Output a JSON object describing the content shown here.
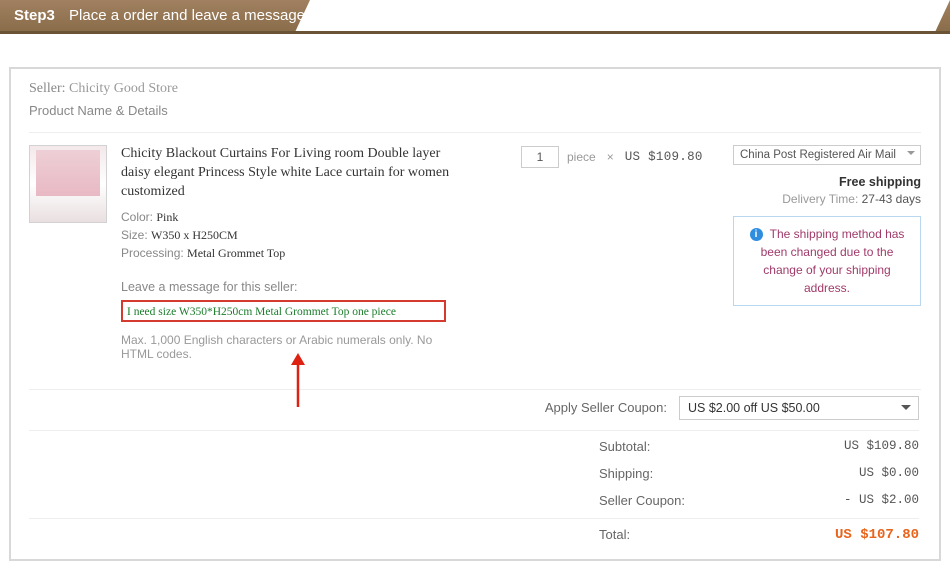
{
  "header": {
    "step": "Step3",
    "title": "Place a order and leave a message"
  },
  "seller": {
    "label": "Seller:",
    "name": "Chicity Good Store"
  },
  "product_name_details_label": "Product Name & Details",
  "product": {
    "title": "Chicity Blackout Curtains For Living room Double layer daisy elegant Princess Style white Lace curtain for women customized",
    "color_label": "Color:",
    "color": "Pink",
    "size_label": "Size:",
    "size": "W350 x H250CM",
    "processing_label": "Processing:",
    "processing": "Metal Grommet Top"
  },
  "message": {
    "label": "Leave a message for this seller:",
    "value": "I need size W350*H250cm Metal Grommet Top one piece",
    "hint": "Max. 1,000 English characters or Arabic numerals only. No HTML codes."
  },
  "qty": {
    "value": "1",
    "unit": "piece",
    "times": "×",
    "price": "US $109.80"
  },
  "shipping": {
    "method": "China Post Registered Air Mail",
    "free_label": "Free shipping",
    "delivery_label": "Delivery Time:",
    "delivery_days": "27-43 days",
    "info": "The shipping method has been changed due to the change of your shipping address."
  },
  "coupon": {
    "label": "Apply Seller Coupon:",
    "selected": "US $2.00 off US $50.00"
  },
  "summary": {
    "subtotal_label": "Subtotal:",
    "subtotal_val": "US $109.80",
    "shipping_label": "Shipping:",
    "shipping_val": "US $0.00",
    "coupon_label": "Seller Coupon:",
    "coupon_val": "- US $2.00",
    "total_label": "Total:",
    "total_val": "US $107.80"
  }
}
